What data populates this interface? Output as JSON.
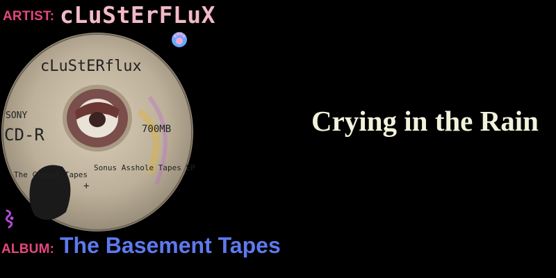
{
  "labels": {
    "artist": "ARTIST:",
    "album": "ALBUM:"
  },
  "artist_name": "cLuStErFLuX",
  "album_name": "The Basement Tapes",
  "song_title": "Crying in the Rain",
  "disc": {
    "handwritten_title": "cLuStERflux",
    "brand": "SONY",
    "format": "CD-R",
    "capacity": "700MB",
    "note_left": "The Closet Tapes",
    "note_plus": "+",
    "note_right": "Sonus Asshole Tapes EP"
  },
  "colors": {
    "label": "#e4477f",
    "artist": "#f2b9c7",
    "album": "#5e79ee",
    "title": "#f2f2dc",
    "background": "#000000"
  },
  "icons": [
    "paw-icon",
    "squiggle-icon"
  ]
}
